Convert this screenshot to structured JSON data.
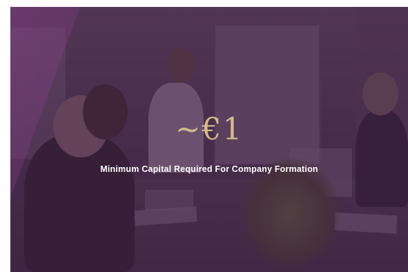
{
  "hero": {
    "headline": "~€1",
    "subline": "Minimum Capital Required For Company Formation"
  },
  "colors": {
    "overlay": "#46204b",
    "headline": "#d3bb8e",
    "subline": "#ffffff"
  }
}
